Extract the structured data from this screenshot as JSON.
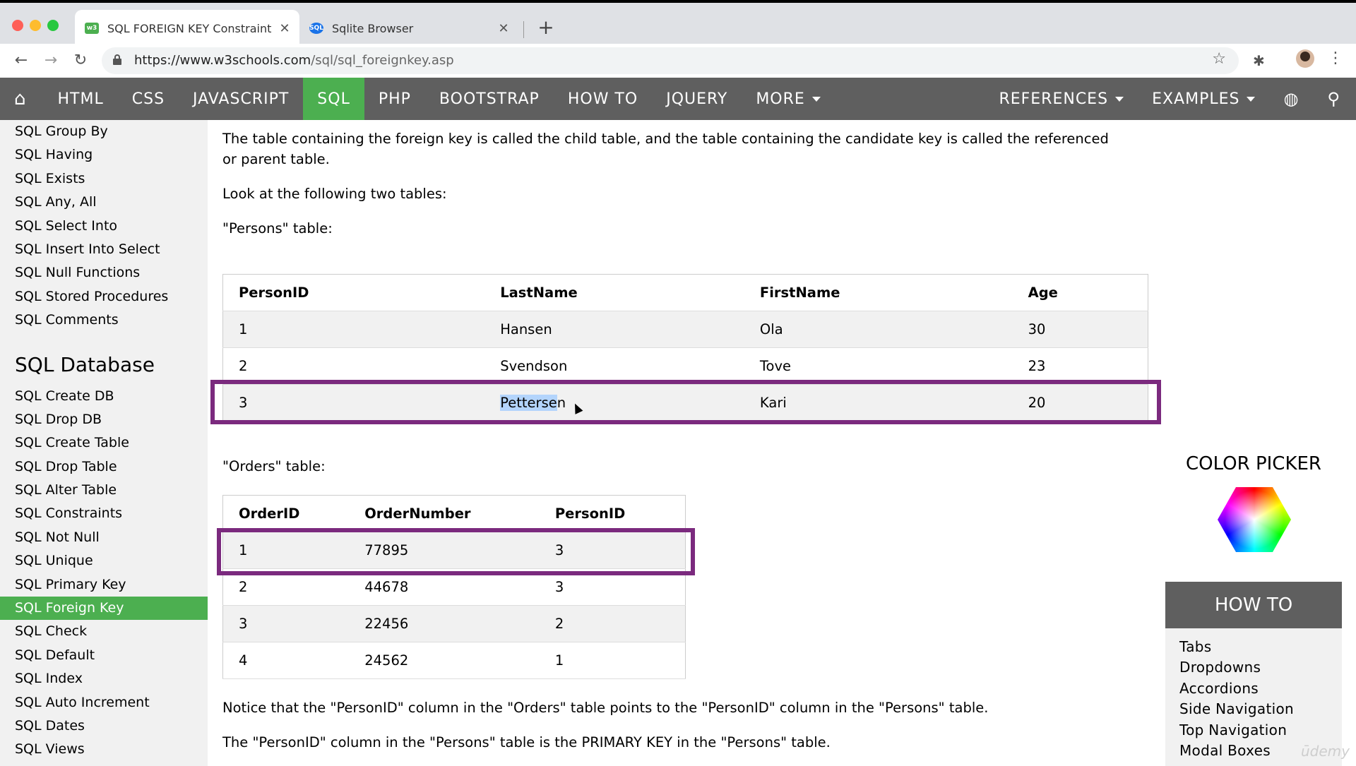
{
  "browser": {
    "tabs": [
      {
        "title": "SQL FOREIGN KEY Constraint",
        "favicon": "w3schools-icon",
        "active": true
      },
      {
        "title": "Sqlite Browser",
        "favicon": "sql-icon",
        "active": false
      }
    ],
    "url_prefix": "https://www.w3schools.com",
    "url_path": "/sql/sql_foreignkey.asp"
  },
  "topnav": {
    "items": [
      "HTML",
      "CSS",
      "JAVASCRIPT",
      "SQL",
      "PHP",
      "BOOTSTRAP",
      "HOW TO",
      "JQUERY"
    ],
    "more": "MORE",
    "references": "REFERENCES",
    "examples": "EXAMPLES",
    "active": "SQL",
    "accent_color": "#4CAF50"
  },
  "sidebar": {
    "items_top": [
      "SQL Group By",
      "SQL Having",
      "SQL Exists",
      "SQL Any, All",
      "SQL Select Into",
      "SQL Insert Into Select",
      "SQL Null Functions",
      "SQL Stored Procedures",
      "SQL Comments"
    ],
    "section_title": "SQL Database",
    "items_db": [
      "SQL Create DB",
      "SQL Drop DB",
      "SQL Create Table",
      "SQL Drop Table",
      "SQL Alter Table",
      "SQL Constraints",
      "SQL Not Null",
      "SQL Unique",
      "SQL Primary Key",
      "SQL Foreign Key",
      "SQL Check",
      "SQL Default",
      "SQL Index",
      "SQL Auto Increment",
      "SQL Dates",
      "SQL Views"
    ],
    "active": "SQL Foreign Key"
  },
  "main": {
    "intro_line1": "The table containing the foreign key is called the child table, and the table containing the candidate key is called the referenced",
    "intro_line2": "or parent table.",
    "look": "Look at the following two tables:",
    "persons_label": "\"Persons\" table:",
    "persons": {
      "headers": [
        "PersonID",
        "LastName",
        "FirstName",
        "Age"
      ],
      "rows": [
        [
          "1",
          "Hansen",
          "Ola",
          "30"
        ],
        [
          "2",
          "Svendson",
          "Tove",
          "23"
        ],
        [
          "3",
          "Pettersen",
          "Kari",
          "20"
        ]
      ],
      "selected_text": "Petterse",
      "unselected_tail": "n"
    },
    "orders_label": "\"Orders\" table:",
    "orders": {
      "headers": [
        "OrderID",
        "OrderNumber",
        "PersonID"
      ],
      "rows": [
        [
          "1",
          "77895",
          "3"
        ],
        [
          "2",
          "44678",
          "3"
        ],
        [
          "3",
          "22456",
          "2"
        ],
        [
          "4",
          "24562",
          "1"
        ]
      ]
    },
    "notice": "Notice that the \"PersonID\" column in the \"Orders\" table points to the \"PersonID\" column in the \"Persons\" table.",
    "primary": "The \"PersonID\" column in the \"Persons\" table is the PRIMARY KEY in the \"Persons\" table.",
    "highlight_color": "#7b2a7e"
  },
  "right": {
    "color_picker_title": "COLOR PICKER",
    "howto_title": "HOW TO",
    "howto_items": [
      "Tabs",
      "Dropdowns",
      "Accordions",
      "Side Navigation",
      "Top Navigation",
      "Modal Boxes"
    ]
  },
  "watermark": "ūdemy"
}
